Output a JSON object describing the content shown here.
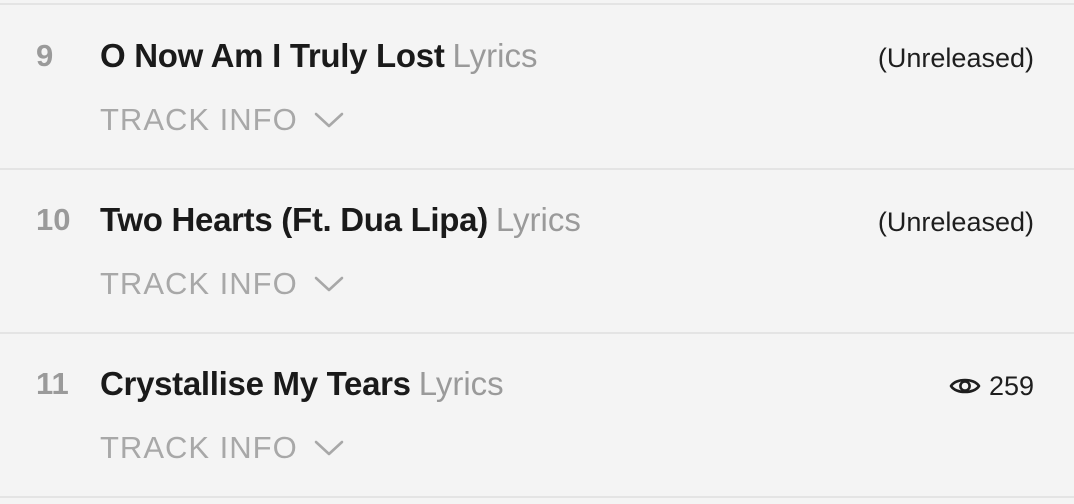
{
  "tracks": [
    {
      "number": "9",
      "title": "O Now Am I Truly Lost",
      "lyrics_label": "Lyrics",
      "track_info_label": "TRACK INFO",
      "status": "(Unreleased)"
    },
    {
      "number": "10",
      "title": "Two Hearts (Ft. Dua Lipa)",
      "lyrics_label": "Lyrics",
      "track_info_label": "TRACK INFO",
      "status": "(Unreleased)"
    },
    {
      "number": "11",
      "title": "Crystallise My Tears",
      "lyrics_label": "Lyrics",
      "track_info_label": "TRACK INFO",
      "views": "259",
      "views_icon": "eye-icon"
    }
  ],
  "colors": {
    "background": "#f4f4f4",
    "number": "#9a9a9a",
    "title": "#1a1a1a",
    "muted": "#a8a8a8"
  }
}
